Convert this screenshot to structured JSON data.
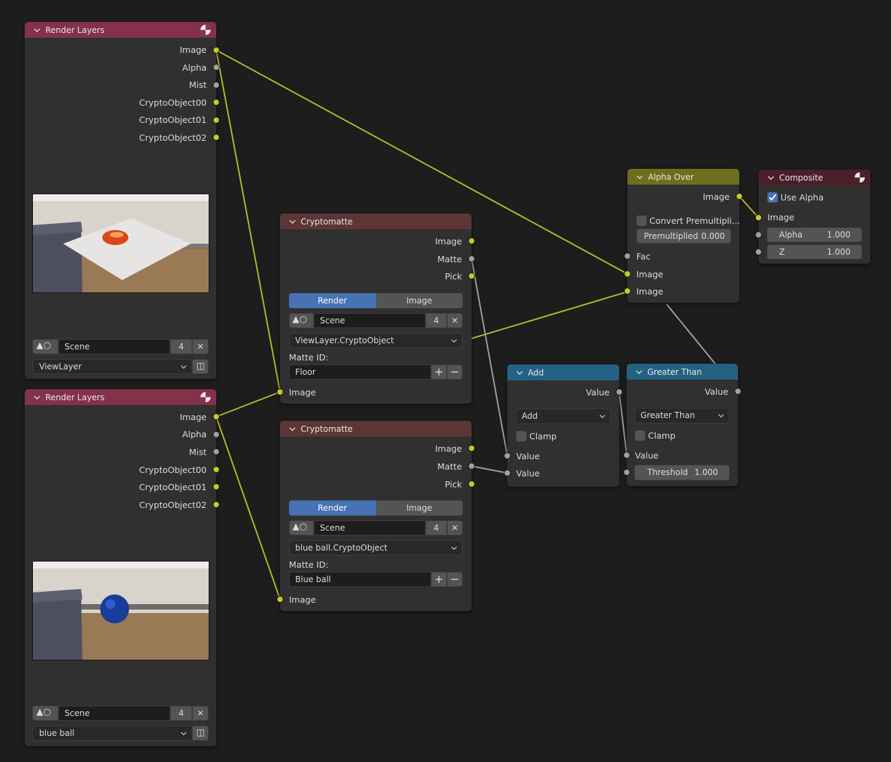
{
  "editor": "Compositor node editor",
  "colors": {
    "image_socket": "#c7c729",
    "value_socket": "#a1a1a1",
    "input_header": "#843149",
    "matte_header": "#5d3535",
    "mix_header": "#6e6e1d",
    "output_header": "#4b1e28",
    "converter_header": "#246283",
    "active_tab": "#4772b3"
  },
  "nodes": {
    "render_layers_1": {
      "title": "Render Layers",
      "header_icon": "render-result-icon",
      "outputs": [
        "Image",
        "Alpha",
        "Mist",
        "CryptoObject00",
        "CryptoObject01",
        "CryptoObject02"
      ],
      "preview": "Render preview: white floor plane with orange ball in a room",
      "scene_icon": "scene-datablock-icon",
      "scene": "Scene",
      "users": "4",
      "view_layer": "ViewLayer"
    },
    "render_layers_2": {
      "title": "Render Layers",
      "header_icon": "render-result-icon",
      "outputs": [
        "Image",
        "Alpha",
        "Mist",
        "CryptoObject00",
        "CryptoObject01",
        "CryptoObject02"
      ],
      "preview": "Render preview: blue ball floating over wooden floor",
      "scene_icon": "scene-datablock-icon",
      "scene": "Scene",
      "users": "4",
      "view_layer": "blue ball"
    },
    "cryptomatte_1": {
      "title": "Cryptomatte",
      "outputs": [
        "Image",
        "Matte",
        "Pick"
      ],
      "tabs": [
        "Render",
        "Image"
      ],
      "active_tab": "Render",
      "scene": "Scene",
      "users": "4",
      "layer": "ViewLayer.CryptoObject",
      "matte_id_label": "Matte ID:",
      "matte_id": "Floor",
      "input": "Image"
    },
    "cryptomatte_2": {
      "title": "Cryptomatte",
      "outputs": [
        "Image",
        "Matte",
        "Pick"
      ],
      "tabs": [
        "Render",
        "Image"
      ],
      "active_tab": "Render",
      "scene": "Scene",
      "users": "4",
      "layer": "blue ball.CryptoObject",
      "matte_id_label": "Matte ID:",
      "matte_id": "Blue ball",
      "input": "Image"
    },
    "alpha_over": {
      "title": "Alpha Over",
      "output": "Image",
      "convert_premultiplied_label": "Convert Premultipli...",
      "convert_premultiplied": false,
      "premultiplied_label": "Premultiplied",
      "premultiplied_value": "0.000",
      "inputs": [
        "Fac",
        "Image",
        "Image"
      ]
    },
    "composite": {
      "title": "Composite",
      "header_icon": "render-result-icon",
      "use_alpha_label": "Use Alpha",
      "use_alpha": true,
      "inputs": {
        "image": "Image",
        "alpha_label": "Alpha",
        "alpha_value": "1.000",
        "z_label": "Z",
        "z_value": "1.000"
      }
    },
    "add": {
      "title": "Add",
      "output": "Value",
      "operation": "Add",
      "clamp_label": "Clamp",
      "clamp": false,
      "inputs": [
        "Value",
        "Value"
      ]
    },
    "greater_than": {
      "title": "Greater Than",
      "output": "Value",
      "operation": "Greater Than",
      "clamp_label": "Clamp",
      "clamp": false,
      "input": "Value",
      "threshold_label": "Threshold",
      "threshold_value": "1.000"
    }
  },
  "links": [
    {
      "from": "render_layers_1.Image",
      "to": "alpha_over.Image1",
      "type": "image"
    },
    {
      "from": "render_layers_1.Image",
      "to": "cryptomatte_1.Image",
      "type": "image"
    },
    {
      "from": "render_layers_2.Image",
      "to": "cryptomatte_1.Image",
      "type": "image"
    },
    {
      "from": "render_layers_2.Image",
      "to": "cryptomatte_2.Image",
      "type": "image"
    },
    {
      "from": "cryptomatte_1.Image",
      "to": "alpha_over.Image2",
      "type": "image"
    },
    {
      "from": "cryptomatte_1.Matte",
      "to": "add.Value1",
      "type": "value"
    },
    {
      "from": "cryptomatte_2.Matte",
      "to": "add.Value2",
      "type": "value"
    },
    {
      "from": "add.Value",
      "to": "greater_than.Value",
      "type": "value"
    },
    {
      "from": "greater_than.Value",
      "to": "alpha_over.Fac",
      "type": "value"
    },
    {
      "from": "alpha_over.Image",
      "to": "composite.Image",
      "type": "image"
    }
  ]
}
